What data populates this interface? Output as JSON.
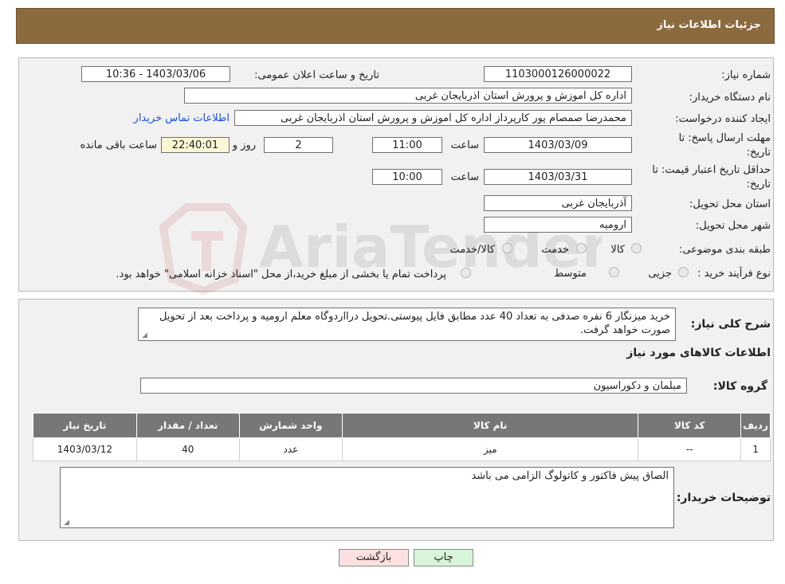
{
  "header": {
    "title": "جزئیات اطلاعات نیاز"
  },
  "need_info": {
    "need_number_label": "شماره نیاز:",
    "need_number": "1103000126000022",
    "announce_label": "تاریخ و ساعت اعلان عمومی:",
    "announce_value": "1403/03/06 - 10:36",
    "buyer_org_label": "نام دستگاه خریدار:",
    "buyer_org": "اداره کل اموزش و پرورش استان اذربایجان غربی",
    "requester_label": "ایجاد کننده درخواست:",
    "requester": "محمدرضا صمصام پور کارپرداز اداره کل اموزش و پرورش استان اذربایجان غربی",
    "contact_link": "اطلاعات تماس خریدار",
    "deadline_label_1": "مهلت ارسال پاسخ: تا",
    "deadline_label_2": "تاریخ:",
    "deadline_date": "1403/03/09",
    "time_label": "ساعت",
    "deadline_time": "11:00",
    "days_value": "2",
    "days_label": "روز و",
    "remaining_time": "22:40:01",
    "remaining_label": "ساعت باقی مانده",
    "validity_label_1": "حداقل تاریخ اعتبار قیمت: تا",
    "validity_label_2": "تاریخ:",
    "validity_date": "1403/03/31",
    "validity_time": "10:00",
    "province_label": "استان محل تحویل:",
    "province": "آذربایجان غربی",
    "city_label": "شهر محل تحویل:",
    "city": "ارومیه",
    "category_label": "طبقه بندی موضوعی:",
    "category_options": [
      "کالا",
      "خدمت",
      "کالا/خدمت"
    ],
    "process_label": "نوع فرآیند خرید :",
    "process_options": [
      "جزیی",
      "متوسط"
    ],
    "payment_note": "پرداخت تمام یا بخشی از مبلغ خرید،از محل \"اسناد خزانه اسلامی\" خواهد بود."
  },
  "description": {
    "label": "شرح کلی نیاز:",
    "text": "خرید میزنگار 6 نفره صدفی به تعداد 40 عدد مطابق فایل پیوستی.تحویل درااردوگاه معلم ارومیه و پرداخت بعد از تحویل صورت خواهد گرفت."
  },
  "goods": {
    "section_title": "اطلاعات کالاهای مورد نیاز",
    "group_label": "گروه کالا:",
    "group_value": "مبلمان و دکوراسیون",
    "columns": [
      "ردیف",
      "کد کالا",
      "نام کالا",
      "واحد شمارش",
      "تعداد / مقدار",
      "تاریخ نیاز"
    ],
    "rows": [
      [
        "1",
        "--",
        "میز",
        "عدد",
        "40",
        "1403/03/12"
      ]
    ]
  },
  "buyer_notes": {
    "label": "توضیحات خریدار:",
    "text": "الصاق پیش فاکتور و کاتولوگ الزامی می باشد"
  },
  "buttons": {
    "print": "چاپ",
    "back": "بازگشت"
  },
  "watermark_text": "AriaTender.neT",
  "colors": {
    "header": "#8b6a40",
    "print_button": "#d9f5d9",
    "back_button": "#fde0e0",
    "table_header": "#777777"
  }
}
